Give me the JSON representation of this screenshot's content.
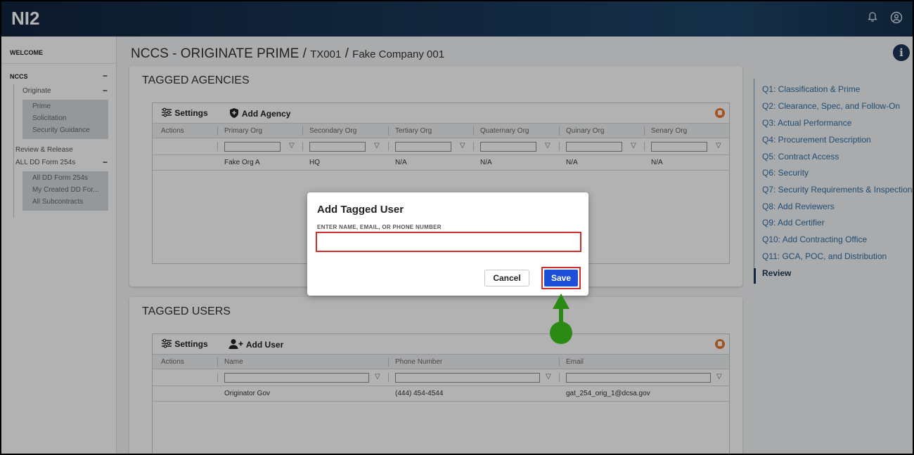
{
  "app": {
    "logo": "NI2"
  },
  "topbar": {
    "bell_icon": "bell-icon",
    "user_icon": "user-circle-icon"
  },
  "sidebar": {
    "welcome": "WELCOME",
    "nccs": "NCCS",
    "nccs_toggle": "−",
    "originate": "Originate",
    "originate_toggle": "−",
    "originate_items": [
      "Prime",
      "Solicitation",
      "Security Guidance"
    ],
    "review_release": "Review & Release",
    "all_dd": "ALL DD Form 254s",
    "all_dd_toggle": "−",
    "all_dd_items": [
      "All DD Form 254s",
      "My Created DD For...",
      "All Subcontracts"
    ]
  },
  "breadcrumb": {
    "root": "NCCS - ORIGINATE PRIME",
    "sep1": "/",
    "record": "TX001",
    "sep2": "/",
    "company": "Fake Company 001"
  },
  "tagged_agencies": {
    "title": "TAGGED AGENCIES",
    "settings_label": "Settings",
    "add_label": "Add Agency",
    "columns": [
      "Actions",
      "Primary Org",
      "Secondary Org",
      "Tertiary Org",
      "Quaternary Org",
      "Quinary Org",
      "Senary Org"
    ],
    "row": [
      "",
      "Fake Org A",
      "HQ",
      "N/A",
      "N/A",
      "N/A",
      "N/A"
    ]
  },
  "tagged_users": {
    "title": "TAGGED USERS",
    "settings_label": "Settings",
    "add_label": "Add User",
    "columns": [
      "Actions",
      "Name",
      "Phone Number",
      "Email"
    ],
    "row": [
      "",
      "Originator Gov",
      "(444) 454-4544",
      "gat_254_orig_1@dcsa.gov"
    ]
  },
  "right_nav": {
    "items": [
      "Q1: Classification & Prime",
      "Q2: Clearance, Spec, and Follow-On",
      "Q3: Actual Performance",
      "Q4: Procurement Description",
      "Q5: Contract Access",
      "Q6: Security",
      "Q7: Security Requirements & Inspection",
      "Q8: Add Reviewers",
      "Q9: Add Certifier",
      "Q10: Add Contracting Office",
      "Q11: GCA, POC, and Distribution",
      "Review"
    ],
    "active": "Review"
  },
  "modal": {
    "title": "Add Tagged User",
    "field_label": "ENTER NAME, EMAIL, OR PHONE NUMBER",
    "field_value": "",
    "cancel_label": "Cancel",
    "save_label": "Save"
  },
  "colors": {
    "topbar": "#12243d",
    "accent_blue": "#1f4fd8",
    "highlight_red": "#d32c2c",
    "arrow_green": "#2a8a14",
    "nav_link": "#2d6fa8"
  }
}
